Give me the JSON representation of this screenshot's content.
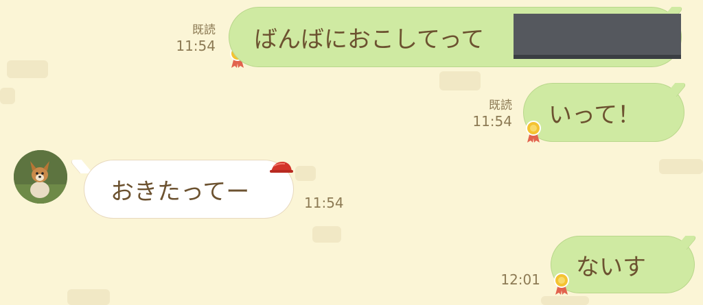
{
  "messages": [
    {
      "direction": "outgoing",
      "text": "ばんばにおこしてって",
      "read_label": "既読",
      "time": "11:54",
      "partially_redacted": true
    },
    {
      "direction": "outgoing",
      "text": "いって！",
      "read_label": "既読",
      "time": "11:54"
    },
    {
      "direction": "incoming",
      "text": "おきたってー",
      "time": "11:54"
    },
    {
      "direction": "outgoing",
      "text": "ないす",
      "time": "12:01"
    }
  ],
  "icons": {
    "medal": "medal-icon",
    "hat": "red-hat-decoration",
    "avatar": "dog-avatar"
  },
  "colors": {
    "background": "#fbf5d6",
    "outgoing_bubble": "#cfeaa2",
    "incoming_bubble": "#ffffff",
    "message_text": "#6c5230",
    "meta_text": "#8c7a54"
  }
}
